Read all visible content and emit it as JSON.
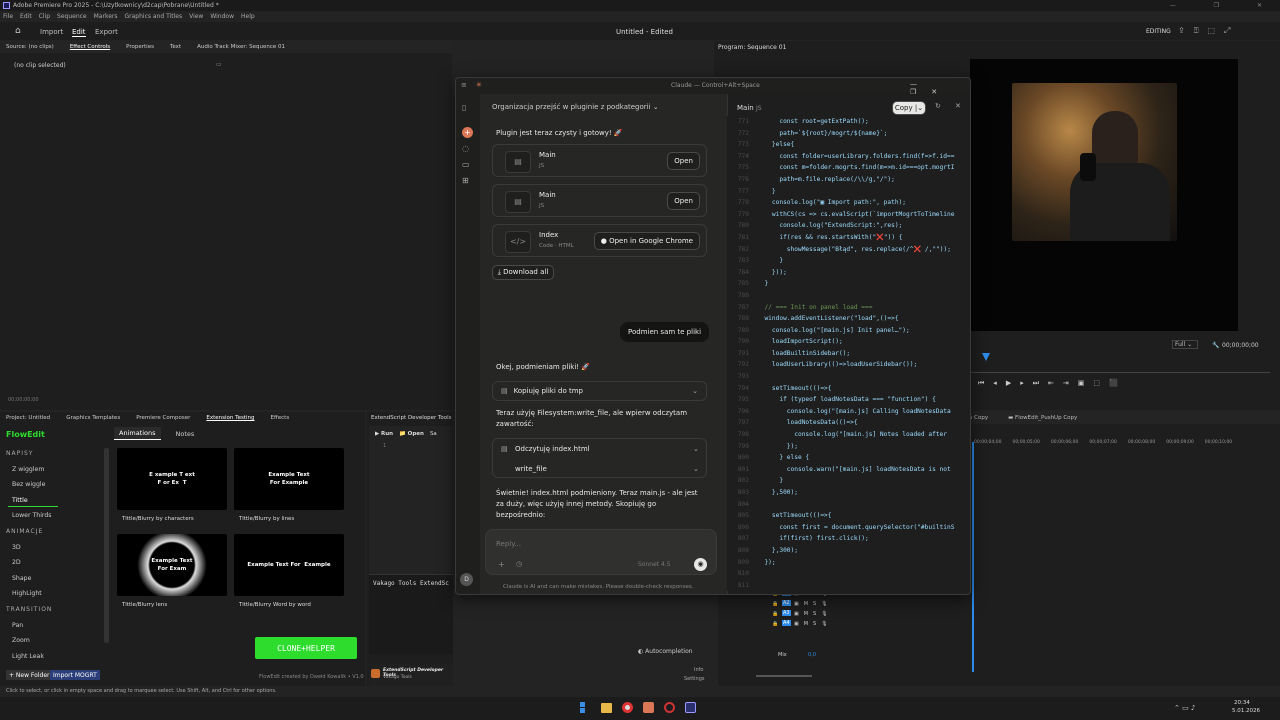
{
  "titlebar": {
    "app": "Adobe Premiere Pro 2025 - C:\\Uzytkownicy\\d2cap\\Pobrane\\Untitled *"
  },
  "menu": [
    "File",
    "Edit",
    "Clip",
    "Sequence",
    "Markers",
    "Graphics and Titles",
    "View",
    "Window",
    "Help"
  ],
  "topnav": {
    "import": "Import",
    "edit": "Edit",
    "export": "Export",
    "doc_title": "Untitled - Edited",
    "workspace": "EDITING"
  },
  "source_panel": {
    "tabs": [
      "Source: (no clips)",
      "Effect Controls",
      "Properties",
      "Text",
      "Audio Track Mixer: Sequence 01"
    ],
    "empty": "(no clip selected)",
    "timecode": "00;00;00;00"
  },
  "program": {
    "title": "Program: Sequence 01",
    "fit": "Full",
    "timecode": "00;00;00;00"
  },
  "project_panel": {
    "tabs": [
      "Project: Untitled",
      "Graphics Templates",
      "Premiere Composer",
      "Extension Testing",
      "Effects"
    ]
  },
  "flowedit": {
    "brand": "FlowEdit",
    "tabs": [
      "Animations",
      "Notes"
    ],
    "sidebar": [
      {
        "label": "NAPISY",
        "header": true
      },
      {
        "label": "Z wigglem"
      },
      {
        "label": "Bez wiggle"
      },
      {
        "label": "Tittle",
        "active": true
      },
      {
        "label": "Lower Thirds"
      },
      {
        "label": "ANIMACJE",
        "header": true
      },
      {
        "label": "3D"
      },
      {
        "label": "2D"
      },
      {
        "label": "Shape"
      },
      {
        "label": "HighLight"
      },
      {
        "label": "TRANSITION",
        "header": true
      },
      {
        "label": "Pan"
      },
      {
        "label": "Zoom"
      },
      {
        "label": "Light Leak"
      }
    ],
    "grid": [
      {
        "thumb": "E xample T ext\nF or Ex  T",
        "label": "Tittle/Blurry by characters"
      },
      {
        "thumb": "Example Text\nFor Example",
        "label": "Tittle/Blurry by lines"
      },
      {
        "thumb": "Example Text\nFor Exam",
        "label": "Tittle/Blurry lens"
      },
      {
        "thumb": "Example Text For  Example",
        "label": "Tittle/Blurry Word by word"
      }
    ],
    "clone_btn": "CLONE+HELPER",
    "new_folder": "+ New Folder",
    "import_mogrt": "Import MOGRT",
    "credit": "FlowEdit created by Dawid Kowalik • V1.0"
  },
  "extendscript": {
    "title": "ExtendScript Developer Tools",
    "run": "Run",
    "open": "Open",
    "save": "Sa",
    "line1": "1",
    "console": "Vakago Tools ExtendSc",
    "autocompletion": "Autocompletion",
    "footer_title": "ExtendScript Developer Tools",
    "footer_sub": "Vakago Tools",
    "info": "Info",
    "settings": "Settings"
  },
  "timeline": {
    "tabs": [
      "ain Copy",
      "FlowEdit_PushUp Copy"
    ],
    "ticks": [
      "00;00;04;00",
      "00;00;05;00",
      "00;00;06;00",
      "00;00;07;00",
      "00;00;08;00",
      "00;00;09;00",
      "00;00;10;00"
    ],
    "tracks": [
      "A1",
      "A2",
      "A3",
      "A4"
    ],
    "mix": "Mix",
    "mix_val": "0,0"
  },
  "statusbar": "Click to select, or click in empty space and drag to marquee select. Use Shift, Alt, and Ctrl for other options.",
  "taskbar": {
    "time": "20:34",
    "date": "5.01.2026"
  },
  "claude": {
    "window_title": "Claude — Control+Alt+Space",
    "chat_title": "Organizacja przejść w pluginie z podkategorii",
    "msg1": "Plugin jest teraz czysty i gotowy! 🚀",
    "files": [
      {
        "name": "Main",
        "type": "JS",
        "action": "Open"
      },
      {
        "name": "Main",
        "type": "JS",
        "action": "Open"
      },
      {
        "name": "Index",
        "type": "Code · HTML",
        "action": "Open in Google Chrome"
      }
    ],
    "download_all": "Download all",
    "user_msg": "Podmien sam te pliki",
    "msg2": "Okej, podmieniam pliki! 🚀",
    "tool1": "Kopiuję pliki do tmp",
    "msg3": "Teraz użyję Filesystem:write_file, ale wpierw odczytam zawartość:",
    "tool2": "Odczytuję index.html",
    "tool2_sub": "write_file",
    "msg4": "Świetnie! index.html podmieniony. Teraz main.js - ale jest za duży, więc użyję innej metody. Skopiuję go bezpośrednio:",
    "reply_placeholder": "Reply...",
    "model": "Sonnet 4.5",
    "disclaimer": "Claude is AI and can make mistakes. Please double-check responses.",
    "avatar": "D",
    "artifact": {
      "title": "Main",
      "lang": "JS",
      "copy": "Copy"
    },
    "code": [
      {
        "n": "771",
        "t": "      const root=getExtPath();"
      },
      {
        "n": "772",
        "t": "      path=`${root}/mogrt/${name}`;"
      },
      {
        "n": "773",
        "t": "    }else{"
      },
      {
        "n": "774",
        "t": "      const folder=userLibrary.folders.find(f=>f.id=="
      },
      {
        "n": "775",
        "t": "      const m=folder.mogrts.find(m=>m.id===opt.mogrtI"
      },
      {
        "n": "776",
        "t": "      path=m.file.replace(/\\\\/g,\"/\");"
      },
      {
        "n": "777",
        "t": "    }"
      },
      {
        "n": "778",
        "t": "    console.log(\"▣ Import path:\", path);"
      },
      {
        "n": "779",
        "t": "    withCS(cs => cs.evalScript(`importMogrtToTimeline"
      },
      {
        "n": "780",
        "t": "      console.log(\"ExtendScript:\",res);"
      },
      {
        "n": "781",
        "t": "      if(res && res.startsWith(\"❌\")) {"
      },
      {
        "n": "782",
        "t": "        showMessage(\"Błąd\", res.replace(/^❌ /,\"\"));"
      },
      {
        "n": "783",
        "t": "      }"
      },
      {
        "n": "784",
        "t": "    }));"
      },
      {
        "n": "785",
        "t": "  }"
      },
      {
        "n": "786",
        "t": ""
      },
      {
        "n": "787",
        "t": "  // === Init on panel load ==="
      },
      {
        "n": "788",
        "t": "  window.addEventListener(\"load\",()=>{"
      },
      {
        "n": "789",
        "t": "    console.log(\"[main.js] Init panel…\");"
      },
      {
        "n": "790",
        "t": "    loadImportScript();"
      },
      {
        "n": "791",
        "t": "    loadBuiltinSidebar();"
      },
      {
        "n": "792",
        "t": "    loadUserLibrary(()=>loadUserSidebar());"
      },
      {
        "n": "793",
        "t": ""
      },
      {
        "n": "794",
        "t": "    setTimeout(()=>{"
      },
      {
        "n": "795",
        "t": "      if (typeof loadNotesData === \"function\") {"
      },
      {
        "n": "796",
        "t": "        console.log(\"[main.js] Calling loadNotesData"
      },
      {
        "n": "797",
        "t": "        loadNotesData(()=>{"
      },
      {
        "n": "798",
        "t": "          console.log(\"[main.js] Notes loaded after"
      },
      {
        "n": "799",
        "t": "        });"
      },
      {
        "n": "800",
        "t": "      } else {"
      },
      {
        "n": "801",
        "t": "        console.warn(\"[main.js] loadNotesData is not"
      },
      {
        "n": "802",
        "t": "      }"
      },
      {
        "n": "803",
        "t": "    },500);"
      },
      {
        "n": "804",
        "t": ""
      },
      {
        "n": "805",
        "t": "    setTimeout(()=>{"
      },
      {
        "n": "806",
        "t": "      const first = document.querySelector(\"#builtinS"
      },
      {
        "n": "807",
        "t": "      if(first) first.click();"
      },
      {
        "n": "808",
        "t": "    },300);"
      },
      {
        "n": "809",
        "t": "  });"
      },
      {
        "n": "810",
        "t": ""
      },
      {
        "n": "811",
        "t": ""
      }
    ]
  },
  "colors": {
    "accent": "#d97757",
    "flowedit": "#2ddc2d",
    "premiere_blue": "#2d8ceb"
  }
}
